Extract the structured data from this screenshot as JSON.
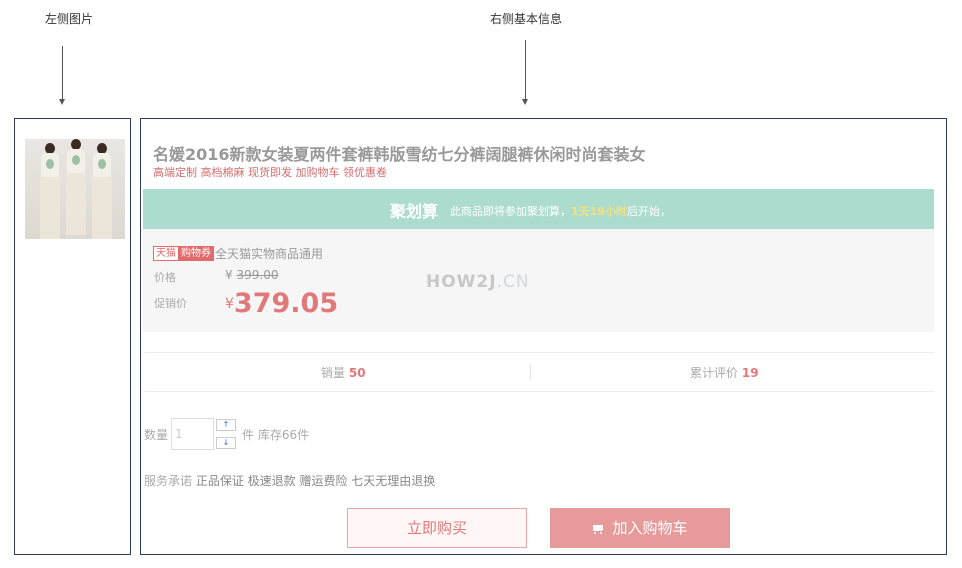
{
  "annotations": {
    "left_label": "左侧图片",
    "right_label": "右侧基本信息"
  },
  "product": {
    "title": "名媛2016新款女装夏两件套裤韩版雪纺七分裤阔腿裤休闲时尚套装女",
    "subtitle": "高端定制 高档棉麻 现货即发 加购物车 领优惠卷"
  },
  "juhuasuan": {
    "logo": "聚划算",
    "text_before": "此商品即将参加聚划算，",
    "time": "1天19小时",
    "text_after": "后开始，"
  },
  "price": {
    "tag_tmall": "天猫",
    "tag_coupon": "购物券",
    "tag_desc": "全天猫实物商品通用",
    "original_label": "价格",
    "currency": "¥",
    "original_value": "399.00",
    "promo_label": "促销价",
    "promo_value": "379.05",
    "watermark_main": "HOW2J",
    "watermark_suffix": ".CN"
  },
  "stats": {
    "sales_label": "销量",
    "sales_value": "50",
    "reviews_label": "累计评价",
    "reviews_value": "19"
  },
  "purchase": {
    "qty_label": "数量",
    "qty_value": "1",
    "stepper_up": "↑",
    "stepper_down": "↓",
    "stock_text": "件 库存66件",
    "service_label": "服务承诺",
    "service_items": "正品保证 极速退款 赠运费险 七天无理由退换",
    "buy_now": "立即购买",
    "add_to_cart": "加入购物车"
  },
  "colors": {
    "accent": "#e07a7a",
    "juhuasuan_bg": "#acdccd",
    "frame": "#2e3b5e"
  }
}
